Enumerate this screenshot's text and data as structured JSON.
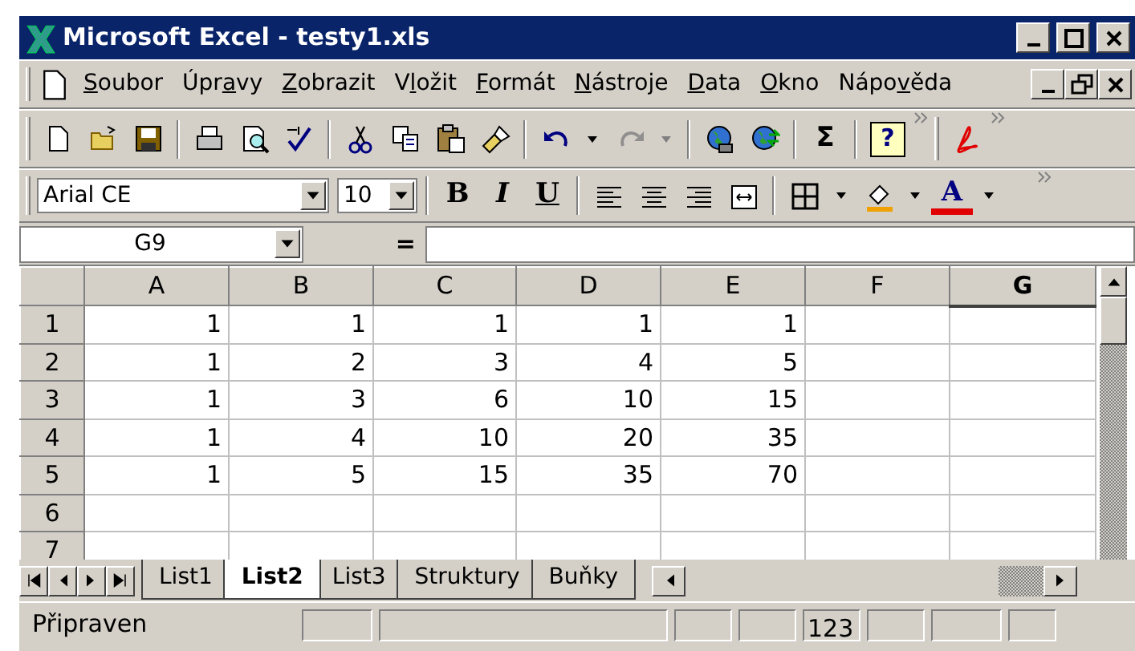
{
  "window": {
    "title": "Microsoft Excel - testy1.xls"
  },
  "menu": [
    {
      "key": "S",
      "post": "oubor"
    },
    {
      "pre": "Úpr",
      "key": "a",
      "post": "vy"
    },
    {
      "key": "Z",
      "post": "obrazit"
    },
    {
      "pre": "V",
      "key": "l",
      "post": "ožit"
    },
    {
      "key": "F",
      "post": "ormát"
    },
    {
      "key": "N",
      "post": "ástroje"
    },
    {
      "key": "D",
      "post": "ata"
    },
    {
      "key": "O",
      "post": "kno"
    },
    {
      "pre": "Nápo",
      "key": "v",
      "post": "ěda"
    }
  ],
  "standard_toolbar": {
    "sum": "Σ",
    "help": "?"
  },
  "formatting_toolbar": {
    "font": "Arial CE",
    "size": "10",
    "styles": [
      "B",
      "I",
      "U"
    ],
    "font_color": "A"
  },
  "formula_bar": {
    "name_box": "G9",
    "equals": "="
  },
  "sheet": {
    "columns": [
      {
        "label": "A",
        "selected": false
      },
      {
        "label": "B",
        "selected": false
      },
      {
        "label": "C",
        "selected": false
      },
      {
        "label": "D",
        "selected": false
      },
      {
        "label": "E",
        "selected": false
      },
      {
        "label": "F",
        "selected": false
      },
      {
        "label": "G",
        "selected": true
      }
    ],
    "rows": [
      {
        "header": "1",
        "cells": [
          "1",
          "1",
          "1",
          "1",
          "1"
        ]
      },
      {
        "header": "2",
        "cells": [
          "1",
          "2",
          "3",
          "4",
          "5"
        ]
      },
      {
        "header": "3",
        "cells": [
          "1",
          "3",
          "6",
          "10",
          "15"
        ]
      },
      {
        "header": "4",
        "cells": [
          "1",
          "4",
          "10",
          "20",
          "35"
        ]
      },
      {
        "header": "5",
        "cells": [
          "1",
          "5",
          "15",
          "35",
          "70"
        ]
      },
      {
        "header": "6",
        "cells": []
      },
      {
        "header": "7",
        "cells": []
      }
    ]
  },
  "sheet_tabs": [
    {
      "label": "List1",
      "selected": false
    },
    {
      "label": "List2",
      "selected": true
    },
    {
      "label": "List3",
      "selected": false
    },
    {
      "label": "Struktury",
      "selected": false
    },
    {
      "label": "Buňky",
      "selected": false
    }
  ],
  "status_bar": {
    "text": "Připraven",
    "indicators": [
      "123"
    ]
  }
}
